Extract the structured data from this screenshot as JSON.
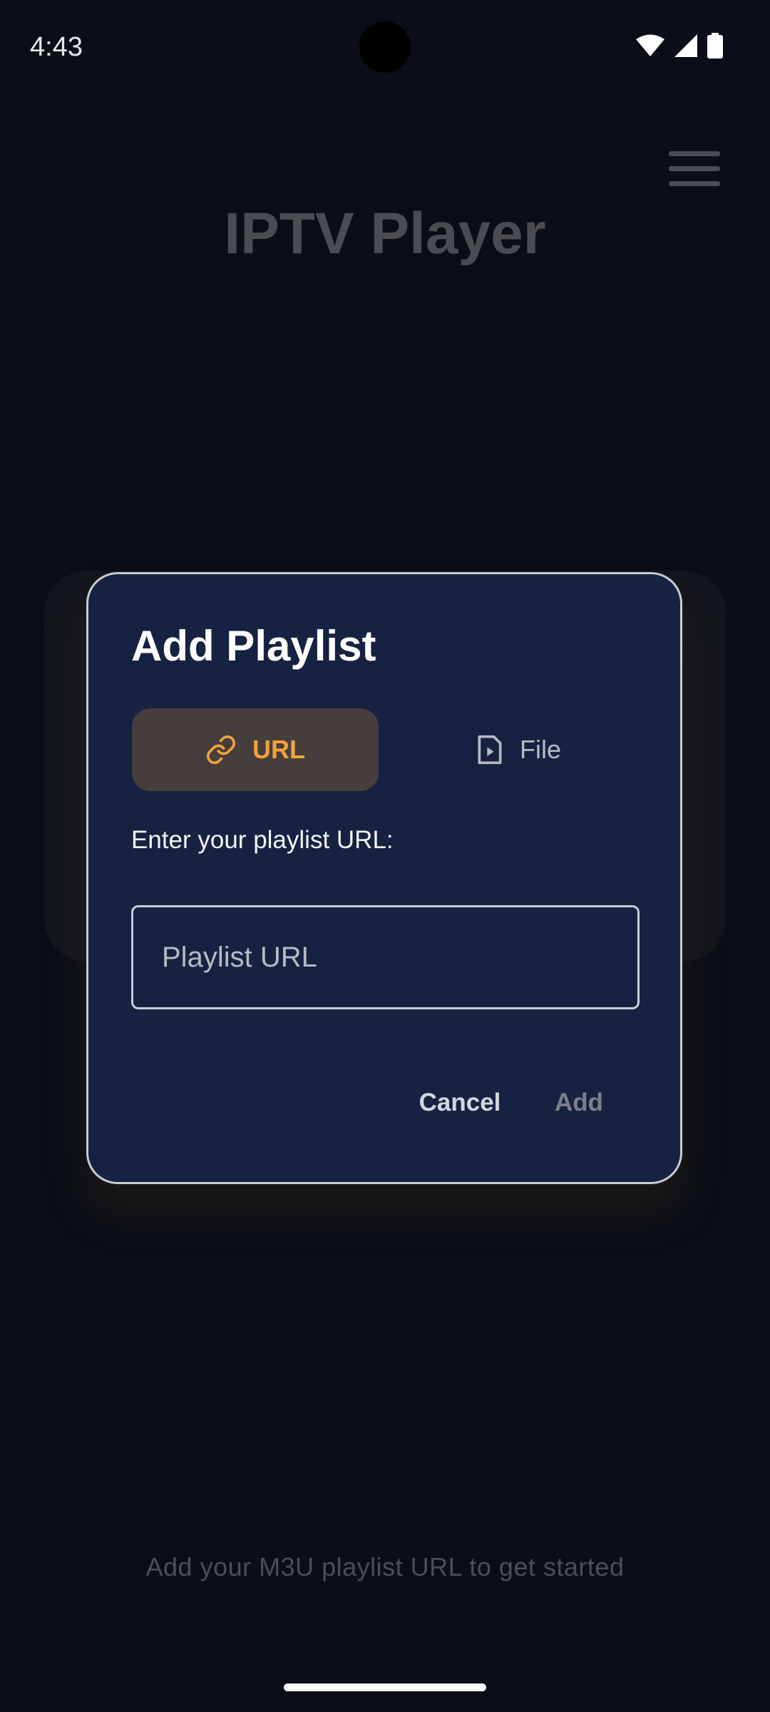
{
  "status_bar": {
    "time": "4:43",
    "icons": [
      "wifi-icon",
      "signal-icon",
      "battery-icon"
    ]
  },
  "app": {
    "title": "IPTV Player",
    "menu_icon": "hamburger-menu-icon",
    "hint": "Add your M3U playlist URL to get started"
  },
  "dialog": {
    "title": "Add Playlist",
    "tabs": [
      {
        "label": "URL",
        "icon": "link-icon",
        "selected": true
      },
      {
        "label": "File",
        "icon": "file-play-icon",
        "selected": false
      }
    ],
    "prompt": "Enter your playlist URL:",
    "input": {
      "placeholder": "Playlist URL",
      "value": ""
    },
    "cancel_label": "Cancel",
    "add_label": "Add"
  },
  "colors": {
    "background": "#0b0e17",
    "dialog_bg": "#172242",
    "accent": "#f0a33a",
    "selected_tab_bg": "#463e3c"
  }
}
